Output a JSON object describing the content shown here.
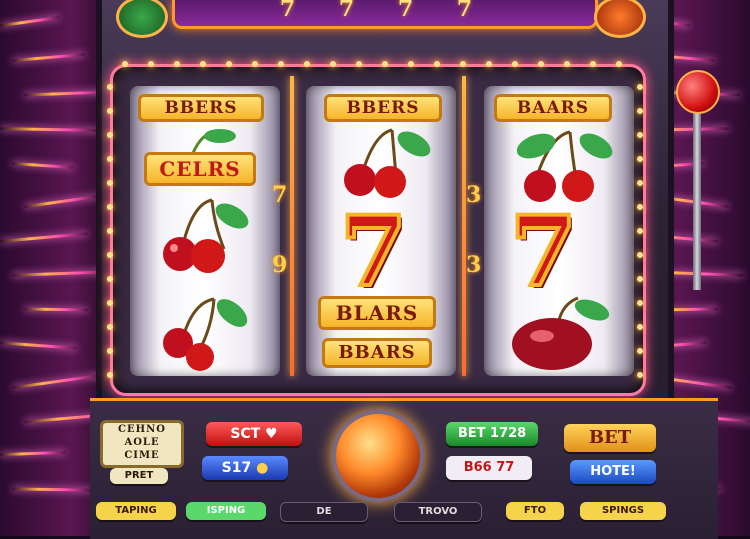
{
  "top_sign": {
    "text": "7 7 7 7"
  },
  "reels": [
    {
      "top_label": "BBERS",
      "label": "CELRS",
      "symbols": [
        "cherries",
        "cherries",
        "cherries"
      ]
    },
    {
      "top_label": "BBERS",
      "label_1": "BLARS",
      "label_2": "BBARS",
      "symbols": [
        "cherries",
        "seven"
      ]
    },
    {
      "top_label": "BAARS",
      "symbols": [
        "cherries",
        "seven",
        "plum"
      ]
    }
  ],
  "seven_glyph": "7",
  "side_numbers": {
    "left": "7",
    "left_2": "9",
    "right": "3",
    "right_2": "3"
  },
  "controls": {
    "info_plate": "CEHNO\nAOLE\nCIME",
    "bet_left_1": "SCT",
    "bet_left_2": "S17",
    "pay_label": "PRET",
    "bet_right_1": "BET 1728",
    "bet_right_2": "B66 77",
    "bet_button": "BET",
    "hotel_button": "HOTE!",
    "bottom_1": "TAPING",
    "bottom_2": "ISPING",
    "bottom_3": "DE",
    "bottom_4": "TROVO",
    "bottom_5": "FTO",
    "bottom_6": "SPINGS"
  },
  "colors": {
    "accent": "#ff9a2a",
    "neon": "#ff4fb0",
    "gold": "#f5b52a",
    "red": "#d01818"
  }
}
